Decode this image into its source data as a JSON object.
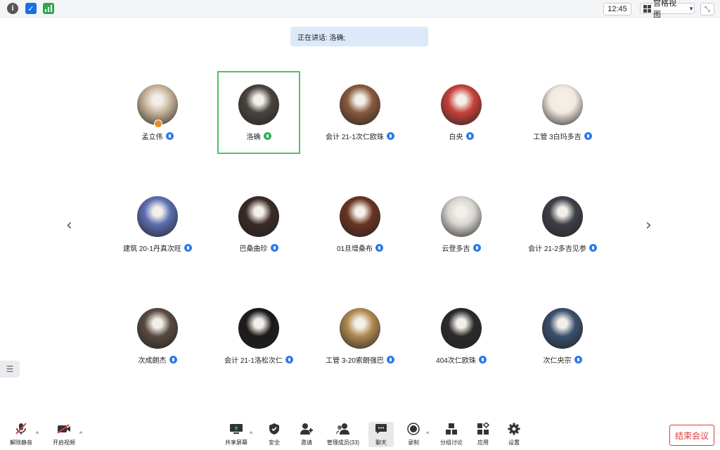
{
  "topbar": {
    "timer": "12:45",
    "view_label": "宫格视图",
    "info_icon": "info-icon",
    "shield_icon": "shield-icon",
    "signal_icon": "signal-icon"
  },
  "speaking": {
    "text": "正在讲话: 洛确;"
  },
  "participants": [
    {
      "name": "孟立伟",
      "mic": "blue",
      "color": "#c8b59a"
    },
    {
      "name": "洛确",
      "mic": "green",
      "color": "#4a4440"
    },
    {
      "name": "会计 21-1次仁欧珠",
      "mic": "blue",
      "color": "#8a5a3c"
    },
    {
      "name": "白央",
      "mic": "blue",
      "color": "#c8413b"
    },
    {
      "name": "工管 3白玛多吉",
      "mic": "blue",
      "color": "#f3e9e1"
    },
    {
      "name": "建筑 20-1丹真次旺",
      "mic": "blue",
      "color": "#5b6fb0"
    },
    {
      "name": "巴桑曲珍",
      "mic": "blue",
      "color": "#3a2a26"
    },
    {
      "name": "01旦增桑布",
      "mic": "blue",
      "color": "#6a3422"
    },
    {
      "name": "云登多吉",
      "mic": "blue",
      "color": "#d9d6d2"
    },
    {
      "name": "会计 21-2多吉见参",
      "mic": "blue",
      "color": "#3e4048"
    },
    {
      "name": "次成朗杰",
      "mic": "blue",
      "color": "#5a4a40"
    },
    {
      "name": "会计 21-1洛松次仁",
      "mic": "blue",
      "color": "#1c1a1a"
    },
    {
      "name": "工管 3-20索朗强巴",
      "mic": "blue",
      "color": "#b08a50"
    },
    {
      "name": "404次仁欧珠",
      "mic": "blue",
      "color": "#2b2b2b"
    },
    {
      "name": "次仁央宗",
      "mic": "blue",
      "color": "#3a4f6e"
    }
  ],
  "toolbar": {
    "unmute": "解除静音",
    "start_video": "开启视频",
    "share_screen": "共享屏幕",
    "security": "安全",
    "invite": "邀请",
    "manage_members": "管理成员(33)",
    "chat": "聊天",
    "record": "录制",
    "breakout": "分组讨论",
    "apps": "应用",
    "settings": "设置",
    "end_meeting": "结束会议"
  },
  "colors": {
    "accent": "#2d7bea",
    "active_border": "#4cc26a",
    "end": "#e03a3a"
  }
}
